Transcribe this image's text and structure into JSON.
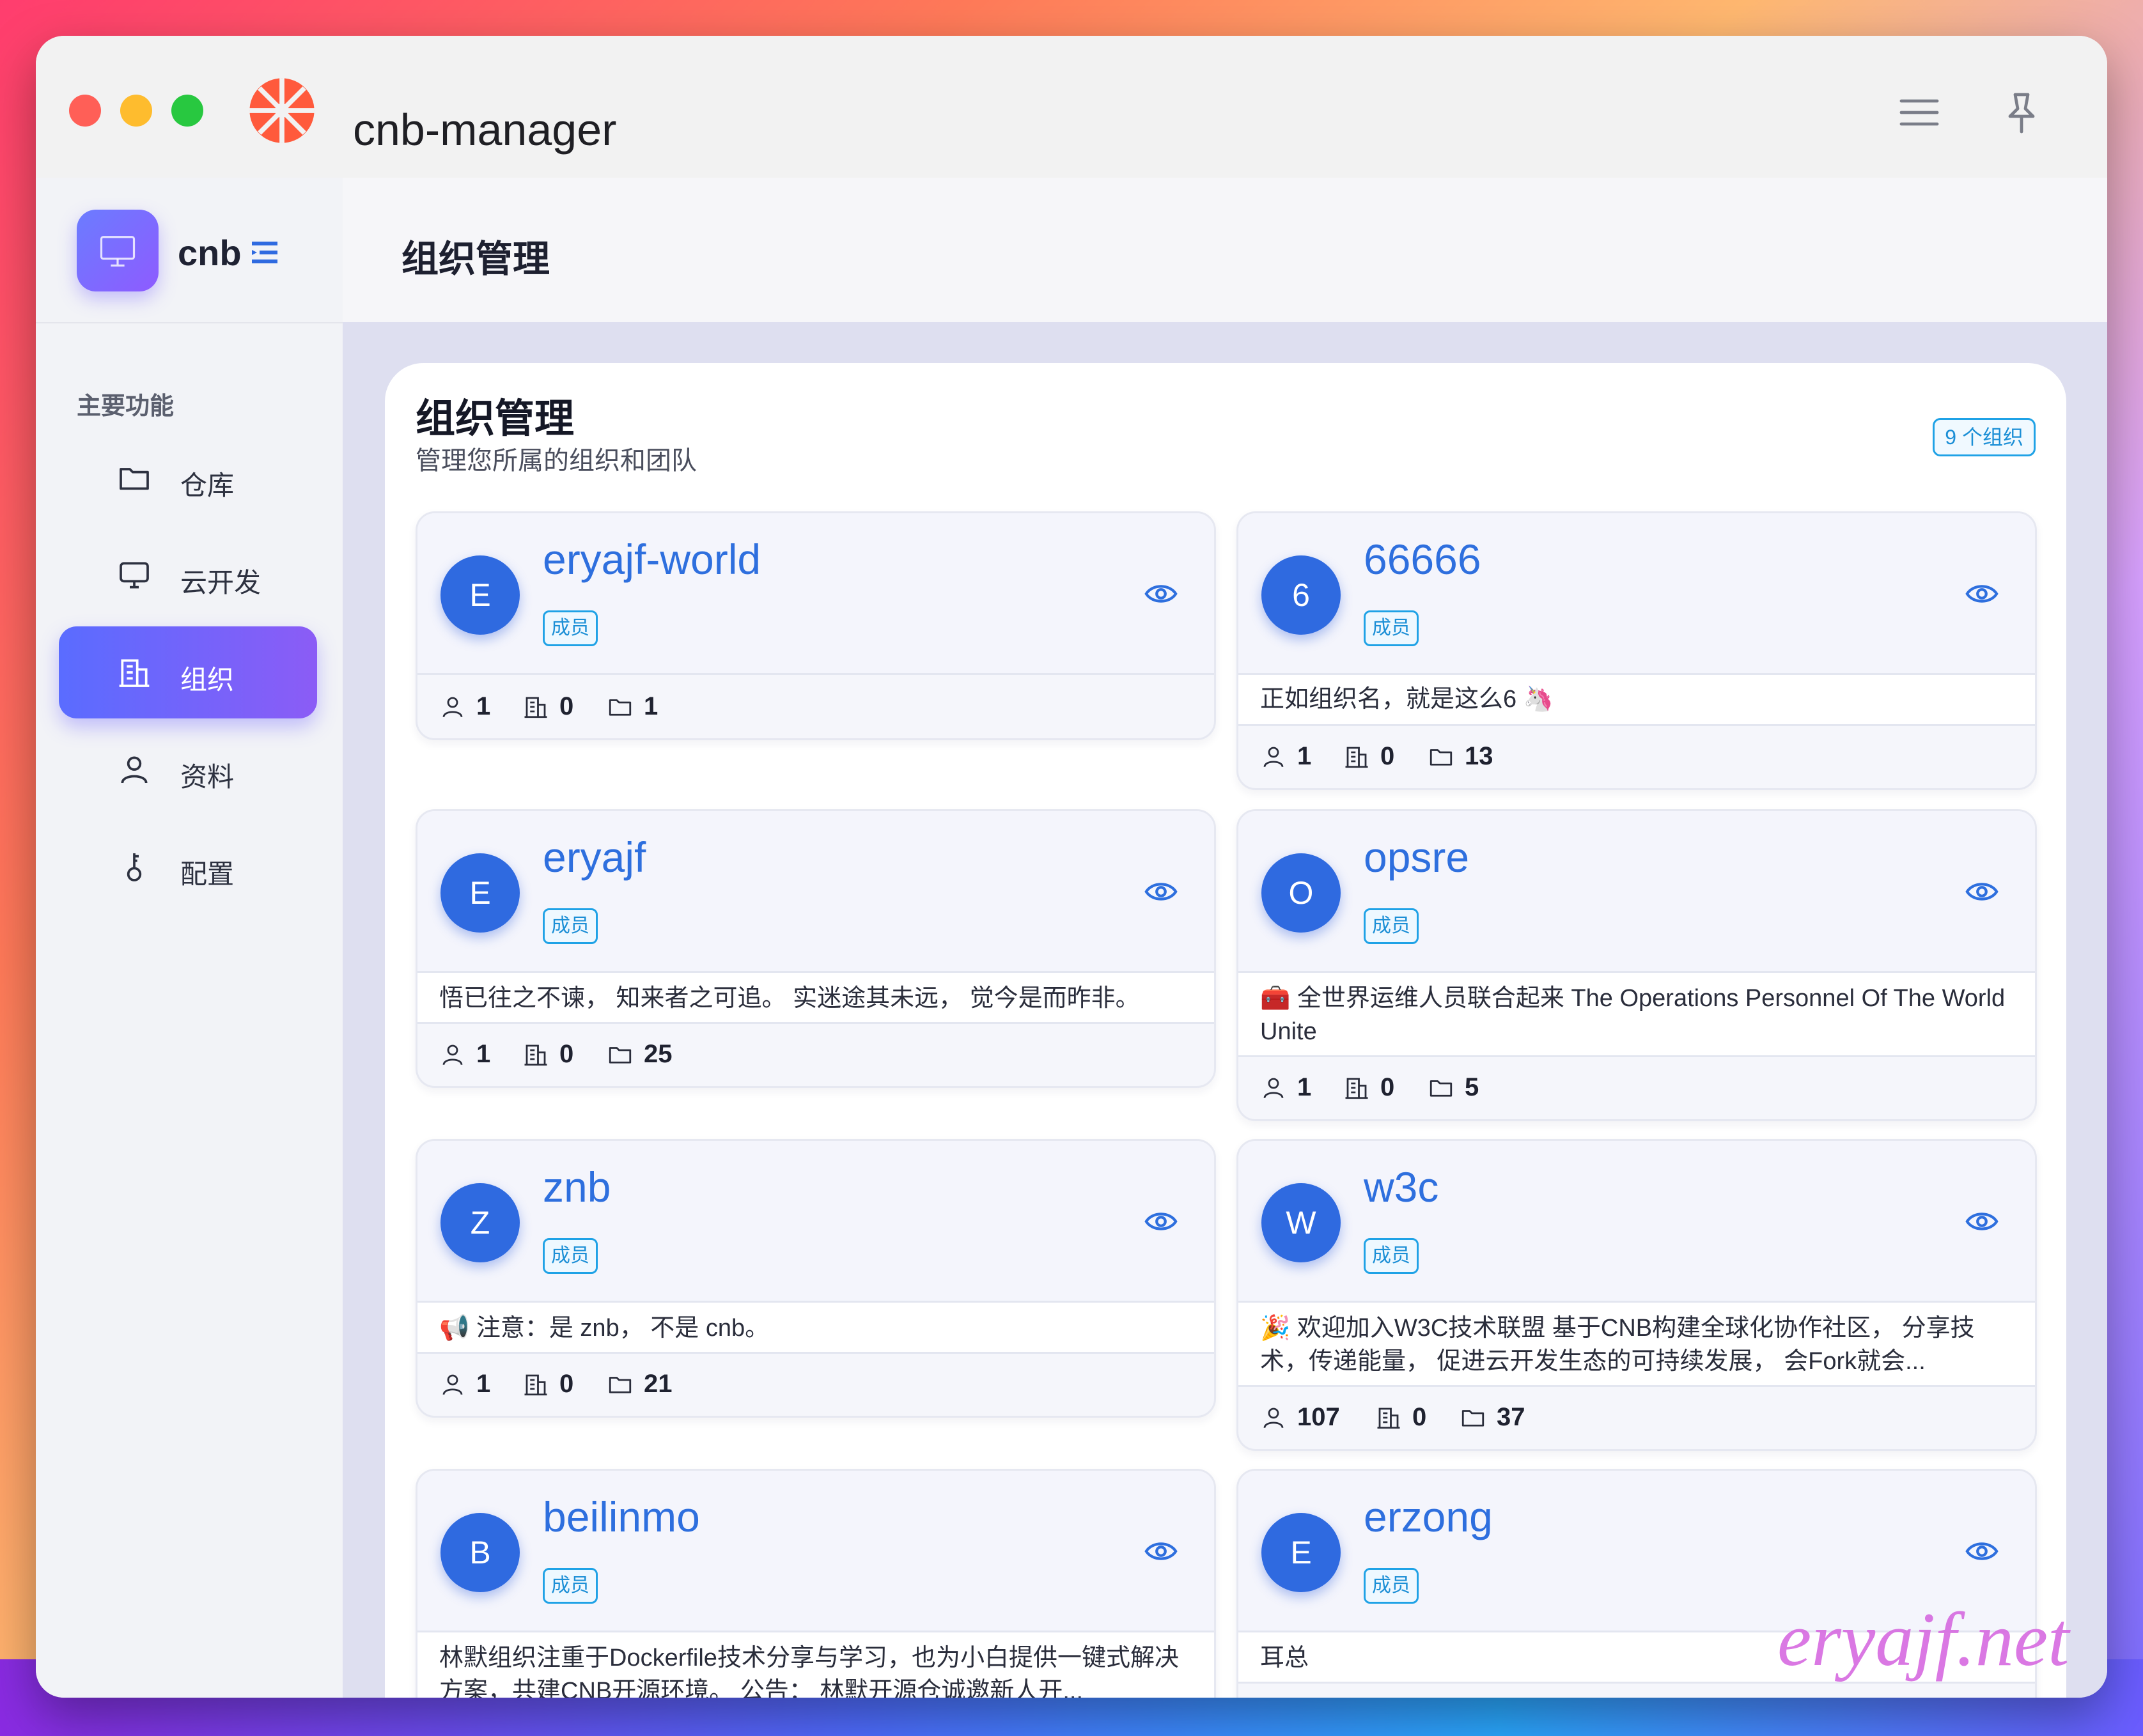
{
  "window": {
    "app_title": "cnb-manager"
  },
  "sidebar": {
    "brand": "cnb",
    "section_title": "主要功能",
    "items": [
      {
        "label": "仓库",
        "icon": "folder-icon"
      },
      {
        "label": "云开发",
        "icon": "monitor-icon"
      },
      {
        "label": "组织",
        "icon": "building-icon",
        "active": true
      },
      {
        "label": "资料",
        "icon": "user-icon"
      },
      {
        "label": "配置",
        "icon": "key-icon"
      }
    ]
  },
  "header": {
    "title": "组织管理"
  },
  "panel": {
    "title": "组织管理",
    "subtitle": "管理您所属的组织和团队",
    "count_badge": "9 个组织"
  },
  "orgs": [
    {
      "avatar": "E",
      "name": "eryajf-world",
      "role": "成员",
      "description": "",
      "members": "1",
      "suborgs": "0",
      "repos": "1"
    },
    {
      "avatar": "6",
      "name": "66666",
      "role": "成员",
      "description": "正如组织名，就是这么6 🦄",
      "members": "1",
      "suborgs": "0",
      "repos": "13"
    },
    {
      "avatar": "E",
      "name": "eryajf",
      "role": "成员",
      "description": "悟已往之不谏， 知来者之可追。 实迷途其未远， 觉今是而昨非。",
      "members": "1",
      "suborgs": "0",
      "repos": "25"
    },
    {
      "avatar": "O",
      "name": "opsre",
      "role": "成员",
      "description": "🧰 全世界运维人员联合起来 The Operations Personnel Of The World Unite",
      "members": "1",
      "suborgs": "0",
      "repos": "5"
    },
    {
      "avatar": "Z",
      "name": "znb",
      "role": "成员",
      "description": "📢 注意：是 znb， 不是 cnb。",
      "members": "1",
      "suborgs": "0",
      "repos": "21"
    },
    {
      "avatar": "W",
      "name": "w3c",
      "role": "成员",
      "description": "🎉 欢迎加入W3C技术联盟 基于CNB构建全球化协作社区， 分享技术，传递能量， 促进云开发生态的可持续发展， 会Fork就会...",
      "members": "107",
      "suborgs": "0",
      "repos": "37"
    },
    {
      "avatar": "B",
      "name": "beilinmo",
      "role": "成员",
      "description": "林默组织注重于Dockerfile技术分享与学习，也为小白提供一键式解决方案，共建CNB开源环境。 公告： 林默开源仓诚邀新人开...",
      "members": "",
      "suborgs": "",
      "repos": ""
    },
    {
      "avatar": "E",
      "name": "erzong",
      "role": "成员",
      "description": "耳总",
      "members": "",
      "suborgs": "",
      "repos": ""
    }
  ],
  "watermark": "eryajf.net",
  "colors": {
    "accent": "#2e6fde",
    "tag": "#1c8fd6",
    "nav_active_start": "#5a6cff",
    "nav_active_end": "#8b5cf6"
  }
}
